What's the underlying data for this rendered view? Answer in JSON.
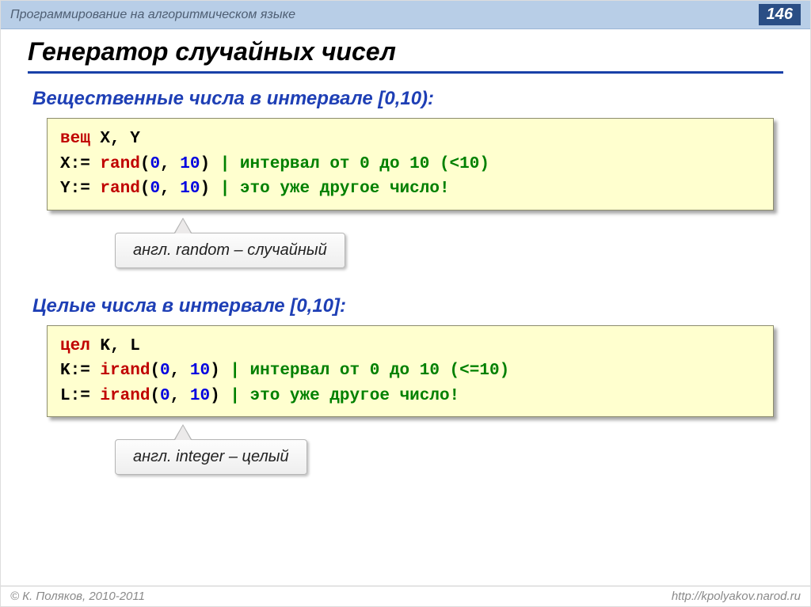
{
  "header": {
    "course_title": "Программирование на алгоритмическом языке",
    "page_number": "146"
  },
  "title": "Генератор случайных чисел",
  "sections": [
    {
      "heading": "Вещественные числа в интервале [0,10):",
      "code": {
        "l1_kw": "вещ",
        "l1_vars": " X, Y",
        "l2_lhs": "X:=",
        "l2_fn": " rand",
        "l2_args_open": "(",
        "l2_arg1": "0",
        "l2_sep": ", ",
        "l2_arg2": "10",
        "l2_args_close": ") ",
        "l2_cmt": "| интервал от 0 до 10 (<10)",
        "l3_lhs": "Y:=",
        "l3_fn": " rand",
        "l3_args_open": "(",
        "l3_arg1": "0",
        "l3_sep": ", ",
        "l3_arg2": "10",
        "l3_args_close": ") ",
        "l3_cmt": "| это уже другое число!"
      },
      "note": "англ. random – случайный"
    },
    {
      "heading": "Целые числа в интервале [0,10]:",
      "code": {
        "l1_kw": "цел",
        "l1_vars": " K, L",
        "l2_lhs": "K:=",
        "l2_fn": " irand",
        "l2_args_open": "(",
        "l2_arg1": "0",
        "l2_sep": ", ",
        "l2_arg2": "10",
        "l2_args_close": ") ",
        "l2_cmt": "| интервал от 0 до 10 (<=10)",
        "l3_lhs": "L:=",
        "l3_fn": " irand",
        "l3_args_open": "(",
        "l3_arg1": "0",
        "l3_sep": ", ",
        "l3_arg2": "10",
        "l3_args_close": ") ",
        "l3_cmt": "| это уже другое число!"
      },
      "note": "англ. integer – целый"
    }
  ],
  "footer": {
    "copyright": "© К. Поляков, 2010-2011",
    "url": "http://kpolyakov.narod.ru"
  }
}
